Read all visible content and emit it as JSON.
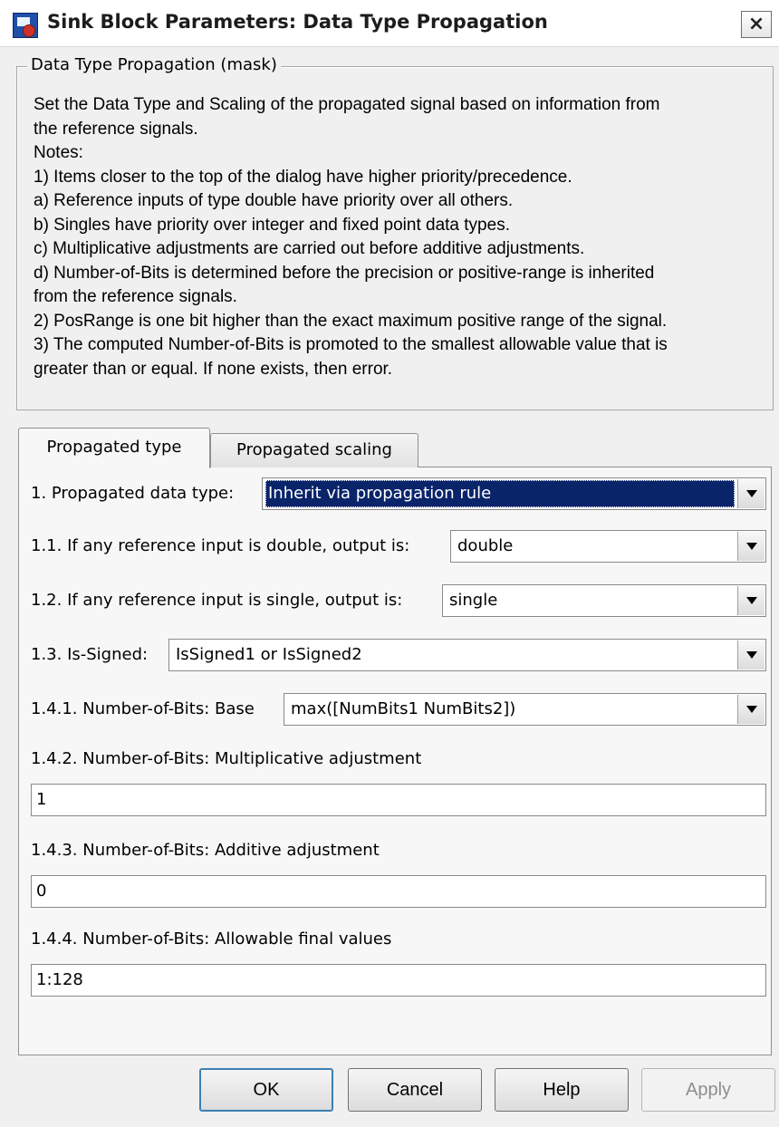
{
  "window": {
    "title": "Sink Block Parameters: Data Type Propagation",
    "close_glyph": "×"
  },
  "mask": {
    "legend": "Data Type Propagation (mask)",
    "description_lines": [
      "Set the Data Type and Scaling of the propagated signal based on information from",
      "the reference signals.",
      "Notes:",
      "1) Items closer to the top of the dialog have higher priority/precedence.",
      "a) Reference inputs of type double have priority over all others.",
      "b) Singles have priority over integer and fixed point data types.",
      "c) Multiplicative adjustments are carried out before additive adjustments.",
      "d) Number-of-Bits is determined before the precision or positive-range is inherited",
      "from the reference signals.",
      "2) PosRange is one bit higher than the exact maximum positive range of the signal.",
      "3) The computed Number-of-Bits is promoted to the smallest allowable value that is",
      "greater than or equal.  If none exists, then error."
    ]
  },
  "tabs": [
    {
      "label": "Propagated type",
      "active": true
    },
    {
      "label": "Propagated scaling",
      "active": false
    }
  ],
  "params": {
    "propagated_data_type": {
      "label": "1. Propagated data type:",
      "value": "Inherit via propagation rule"
    },
    "if_double": {
      "label": "1.1. If any reference input is double, output is:",
      "value": "double"
    },
    "if_single": {
      "label": "1.2. If any reference input is single, output is:",
      "value": "single"
    },
    "is_signed": {
      "label": "1.3. Is-Signed:",
      "value": "IsSigned1 or IsSigned2"
    },
    "nbits_base": {
      "label": "1.4.1. Number-of-Bits: Base",
      "value": "max([NumBits1 NumBits2])"
    },
    "nbits_mult": {
      "label": "1.4.2. Number-of-Bits: Multiplicative adjustment",
      "value": "1"
    },
    "nbits_add": {
      "label": "1.4.3. Number-of-Bits: Additive adjustment",
      "value": "0"
    },
    "nbits_allowable": {
      "label": "1.4.4. Number-of-Bits: Allowable final values",
      "value": "1:128"
    }
  },
  "buttons": {
    "ok": "OK",
    "cancel": "Cancel",
    "help": "Help",
    "apply": "Apply"
  }
}
